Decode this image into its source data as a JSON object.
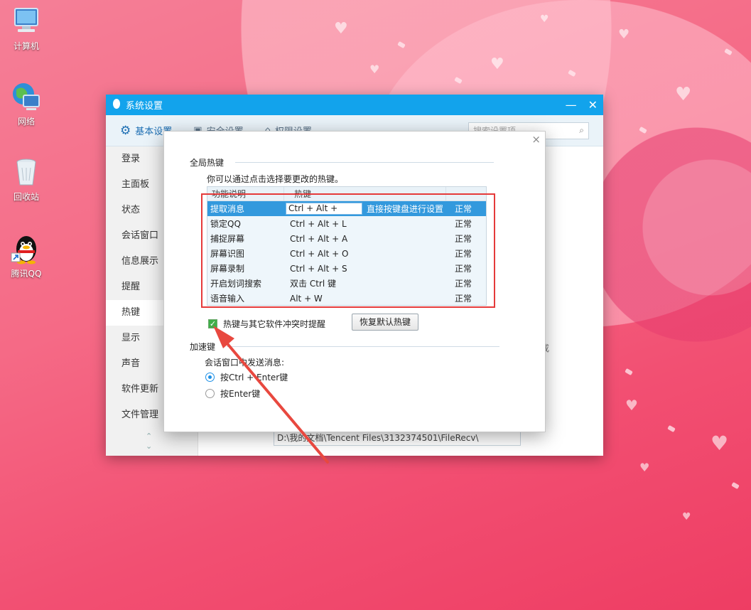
{
  "desktop": {
    "icons": [
      {
        "label": "计算机",
        "icon": "computer-icon"
      },
      {
        "label": "网络",
        "icon": "network-icon"
      },
      {
        "label": "回收站",
        "icon": "recycle-bin-icon"
      },
      {
        "label": "腾讯QQ",
        "icon": "qq-penguin-icon"
      }
    ]
  },
  "window": {
    "title": "系统设置",
    "minimize": "—",
    "close": "✕",
    "tabs": [
      {
        "label": "基本设置",
        "icon": "gear-icon"
      },
      {
        "label": "安全设置",
        "icon": "shield-icon"
      },
      {
        "label": "权限设置",
        "icon": "lock-icon"
      }
    ],
    "search_placeholder": "搜索设置项",
    "sidebar": [
      {
        "label": "登录"
      },
      {
        "label": "主面板"
      },
      {
        "label": "状态"
      },
      {
        "label": "会话窗口"
      },
      {
        "label": "信息展示"
      },
      {
        "label": "提醒"
      },
      {
        "label": "热键"
      },
      {
        "label": "显示"
      },
      {
        "label": "声音"
      },
      {
        "label": "软件更新"
      },
      {
        "label": "文件管理"
      }
    ],
    "file_path": "D:\\我的文档\\Tencent Files\\3132374501\\FileRecv\\",
    "bg_fragment": "或"
  },
  "dialog": {
    "close": "×",
    "global_hotkeys": {
      "title": "全局热键",
      "hint": "你可以通过点击选择要更改的热键。",
      "columns": [
        "功能说明",
        "热键"
      ],
      "rows": [
        {
          "name": "提取消息",
          "key": "Ctrl + Alt +",
          "note": "直接按键盘进行设置",
          "status": "正常"
        },
        {
          "name": "锁定QQ",
          "key": "Ctrl + Alt + L",
          "note": "",
          "status": "正常"
        },
        {
          "name": "捕捉屏幕",
          "key": "Ctrl + Alt + A",
          "note": "",
          "status": "正常"
        },
        {
          "name": "屏幕识图",
          "key": "Ctrl + Alt + O",
          "note": "",
          "status": "正常"
        },
        {
          "name": "屏幕录制",
          "key": "Ctrl + Alt + S",
          "note": "",
          "status": "正常"
        },
        {
          "name": "开启划词搜索",
          "key": "双击 Ctrl 键",
          "note": "",
          "status": "正常"
        },
        {
          "name": "语音输入",
          "key": "Alt + W",
          "note": "",
          "status": "正常"
        }
      ],
      "conflict_checkbox": "热键与其它软件冲突时提醒",
      "restore_button": "恢复默认热键"
    },
    "accelerator": {
      "title": "加速键",
      "subtitle": "会话窗口中发送消息:",
      "options": [
        "按Ctrl + Enter键",
        "按Enter键"
      ],
      "selected": 0
    }
  },
  "colors": {
    "titlebar": "#12a3ec",
    "selection": "#3399dd",
    "highlight_box": "#e53a3a",
    "arrow": "#e8483f"
  }
}
